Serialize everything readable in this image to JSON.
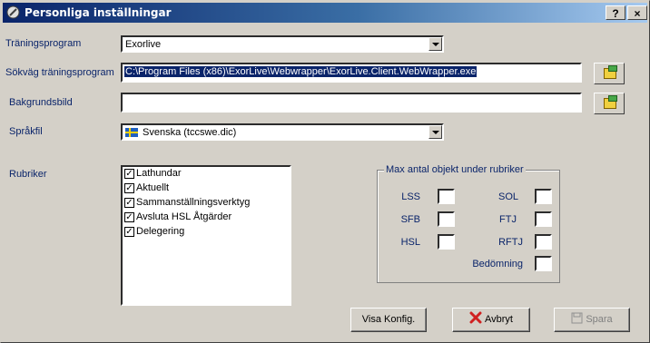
{
  "window": {
    "title": "Personliga inställningar",
    "help_label": "?",
    "close_label": "×"
  },
  "form": {
    "training_program": {
      "label": "Träningsprogram",
      "value": "Exorlive"
    },
    "training_path": {
      "label": "Sökväg träningsprogram",
      "value": "C:\\Program Files (x86)\\ExorLive\\Webwrapper\\ExorLive.Client.WebWrapper.exe"
    },
    "background": {
      "label": "Bakgrundsbild",
      "value": ""
    },
    "language": {
      "label": "Språkfil",
      "value": "Svenska  (tccswe.dic)"
    },
    "headings": {
      "label": "Rubriker",
      "items": [
        {
          "label": "Lathundar",
          "checked": true
        },
        {
          "label": "Aktuellt",
          "checked": true
        },
        {
          "label": "Sammanställningsverktyg",
          "checked": true
        },
        {
          "label": "Avsluta HSL Åtgärder",
          "checked": true
        },
        {
          "label": "Delegering",
          "checked": true
        }
      ]
    },
    "max_objects": {
      "title": "Max antal objekt under rubriker",
      "lss": "LSS",
      "sfb": "SFB",
      "hsl": "HSL",
      "sol": "SOL",
      "ftj": "FTJ",
      "rftj": "RFTJ",
      "bedomning": "Bedömning"
    }
  },
  "buttons": {
    "visa_konfig": "Visa Konfig.",
    "avbryt": "Avbryt",
    "spara": "Spara"
  },
  "colors": {
    "title_gradient_start": "#0a246a",
    "label_color": "#0a246a",
    "face": "#d4d0c8"
  }
}
